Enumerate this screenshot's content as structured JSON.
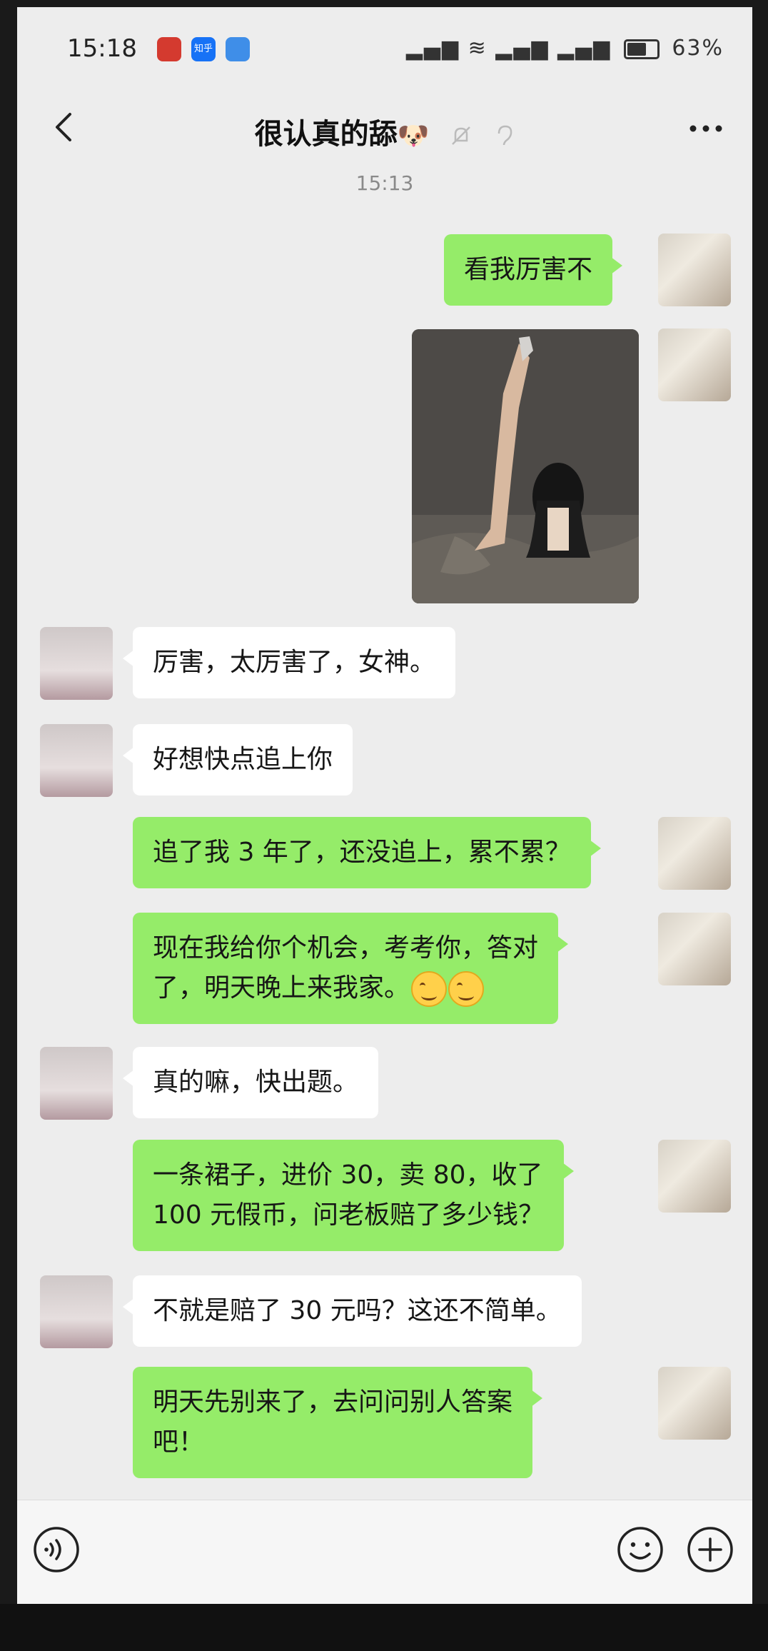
{
  "status_bar": {
    "time": "15:18",
    "apps": [
      "知乎"
    ],
    "battery": "63%"
  },
  "chat": {
    "title": "很认真的舔",
    "title_emoji": "🐶",
    "timestamp": "15:13"
  },
  "messages": [
    {
      "sender": "me",
      "text": "看我厉害不"
    },
    {
      "sender": "me",
      "type": "image"
    },
    {
      "sender": "other",
      "text": "厉害，太厉害了，女神。"
    },
    {
      "sender": "other",
      "text": "好想快点追上你"
    },
    {
      "sender": "me",
      "text": "追了我 3 年了，还没追上，累不累？"
    },
    {
      "sender": "me",
      "text_line1": "现在我给你个机会，考考你，答对",
      "text_line2": "了，明天晚上来我家。"
    },
    {
      "sender": "other",
      "text": "真的嘛，快出题。"
    },
    {
      "sender": "me",
      "text_line1": "一条裙子，进价 30，卖 80，收了",
      "text_line2": "100 元假币，问老板赔了多少钱？"
    },
    {
      "sender": "other",
      "text": "不就是赔了 30 元吗？这还不简单。"
    },
    {
      "sender": "me",
      "text_line1": "明天先别来了，去问问别人答案",
      "text_line2": "吧！"
    }
  ],
  "colors": {
    "my_bubble": "#95ec69",
    "other_bubble": "#ffffff",
    "background": "#ededed"
  }
}
